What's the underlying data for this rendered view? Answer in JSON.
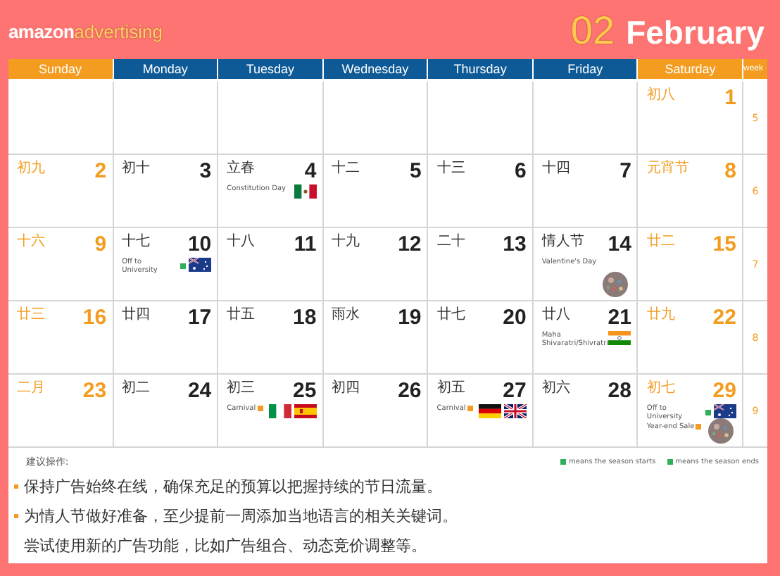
{
  "brand": {
    "name": "amazon",
    "product": "advertising"
  },
  "month": {
    "number": "02",
    "name": "February"
  },
  "columns": [
    {
      "label": "Sunday",
      "weekend": true
    },
    {
      "label": "Monday",
      "weekend": false
    },
    {
      "label": "Tuesday",
      "weekend": false
    },
    {
      "label": "Wednesday",
      "weekend": false
    },
    {
      "label": "Thursday",
      "weekend": false
    },
    {
      "label": "Friday",
      "weekend": false
    },
    {
      "label": "Saturday",
      "weekend": true
    }
  ],
  "week_column": "week",
  "weeks": [
    {
      "week": "5",
      "days": [
        {
          "kind": "blank"
        },
        {
          "kind": "blank"
        },
        {
          "kind": "blank"
        },
        {
          "kind": "blank"
        },
        {
          "kind": "blank"
        },
        {
          "kind": "blank"
        },
        {
          "kind": "day",
          "lunar": "初八",
          "date": "1"
        }
      ]
    },
    {
      "week": "6",
      "days": [
        {
          "kind": "day",
          "lunar": "初九",
          "date": "2"
        },
        {
          "kind": "day",
          "lunar": "初十",
          "date": "3"
        },
        {
          "kind": "day",
          "lunar": "立春",
          "date": "4",
          "events": [
            {
              "text": "Constitution Day"
            }
          ],
          "flags": [
            {
              "kind": "mx"
            }
          ]
        },
        {
          "kind": "day",
          "lunar": "十二",
          "date": "5"
        },
        {
          "kind": "day",
          "lunar": "十三",
          "date": "6"
        },
        {
          "kind": "day",
          "lunar": "十四",
          "date": "7"
        },
        {
          "kind": "day",
          "lunar": "元宵节",
          "date": "8"
        }
      ]
    },
    {
      "week": "7",
      "days": [
        {
          "kind": "day",
          "lunar": "十六",
          "date": "9"
        },
        {
          "kind": "day",
          "lunar": "十七",
          "date": "10",
          "events": [
            {
              "text": "Off to University",
              "color": "#2fae5b"
            }
          ],
          "flags": [
            {
              "kind": "au"
            }
          ]
        },
        {
          "kind": "day",
          "lunar": "十八",
          "date": "11"
        },
        {
          "kind": "day",
          "lunar": "十九",
          "date": "12"
        },
        {
          "kind": "day",
          "lunar": "二十",
          "date": "13"
        },
        {
          "kind": "day",
          "lunar": "情人节",
          "date": "14",
          "events": [
            {
              "text": "Valentine's Day"
            }
          ],
          "sticker": true
        },
        {
          "kind": "day",
          "lunar": "廿二",
          "date": "15"
        }
      ]
    },
    {
      "week": "8",
      "days": [
        {
          "kind": "day",
          "lunar": "廿三",
          "date": "16"
        },
        {
          "kind": "day",
          "lunar": "廿四",
          "date": "17"
        },
        {
          "kind": "day",
          "lunar": "廿五",
          "date": "18"
        },
        {
          "kind": "day",
          "lunar": "雨水",
          "date": "19"
        },
        {
          "kind": "day",
          "lunar": "廿七",
          "date": "20"
        },
        {
          "kind": "day",
          "lunar": "廿八",
          "date": "21",
          "events": [
            {
              "text": "Maha Shivaratri/Shivratri"
            }
          ],
          "flags": [
            {
              "kind": "in"
            }
          ]
        },
        {
          "kind": "day",
          "lunar": "廿九",
          "date": "22"
        }
      ]
    },
    {
      "week": "9",
      "days": [
        {
          "kind": "day",
          "lunar": "二月",
          "date": "23"
        },
        {
          "kind": "day",
          "lunar": "初二",
          "date": "24"
        },
        {
          "kind": "day",
          "lunar": "初三",
          "date": "25",
          "events": [
            {
              "text": "Carnival",
              "color": "#f39c1f"
            }
          ],
          "flags": [
            {
              "kind": "it"
            },
            {
              "kind": "es"
            }
          ]
        },
        {
          "kind": "day",
          "lunar": "初四",
          "date": "26"
        },
        {
          "kind": "day",
          "lunar": "初五",
          "date": "27",
          "events": [
            {
              "text": "Carnival",
              "color": "#f39c1f"
            }
          ],
          "flags": [
            {
              "kind": "de"
            },
            {
              "kind": "gb"
            }
          ]
        },
        {
          "kind": "day",
          "lunar": "初六",
          "date": "28"
        },
        {
          "kind": "day",
          "lunar": "初七",
          "date": "29",
          "events": [
            {
              "text": "Off to University",
              "color": "#2fae5b"
            },
            {
              "text": "Year-end Sale",
              "color": "#f39c1f"
            }
          ],
          "flags": [
            {
              "kind": "au"
            }
          ],
          "sticker": true
        }
      ]
    }
  ],
  "notes": {
    "title": "建议操作:",
    "legend": [
      {
        "color": "#2fae5b",
        "text": "means the season starts"
      },
      {
        "color": "#2fae5b",
        "text": "means the season ends"
      }
    ],
    "tips": [
      {
        "text": "保持广告始终在线，确保充足的预算以把握持续的节日流量。",
        "bullet": true
      },
      {
        "text": "为情人节做好准备，至少提前一周添加当地语言的相关关键词。",
        "bullet": true
      },
      {
        "text": "尝试使用新的广告功能，比如广告组合、动态竞价调整等。",
        "bullet": false
      }
    ]
  }
}
